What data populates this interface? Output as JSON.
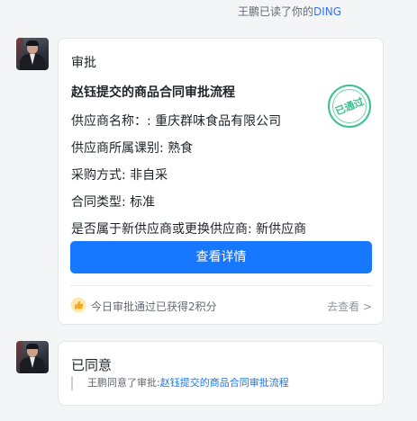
{
  "read_receipt": {
    "prefix": "王鹏已读了你的",
    "ding": "DING"
  },
  "approval_card": {
    "type_label": "审批",
    "title": "赵钰提交的商品合同审批流程",
    "stamp_text": "已通过",
    "fields": {
      "supplier_name": "供应商名称：: 重庆群味食品有限公司",
      "supplier_category": "供应商所属课别: 熟食",
      "purchase_method": "采购方式: 非自采",
      "contract_type": "合同类型: 标准",
      "new_supplier": "是否属于新供应商或更换供应商: 新供应商"
    },
    "detail_button": "查看详情",
    "reward_text": "今日审批通过已获得2积分",
    "reward_link": "去查看 >",
    "colors": {
      "button": "#1677ff",
      "stamp": "#3bbf8f"
    }
  },
  "agree_card": {
    "title": "已同意",
    "quote_prefix": "王鹏同意了审批:",
    "quote_link": "赵钰提交的商品合同审批流程"
  }
}
